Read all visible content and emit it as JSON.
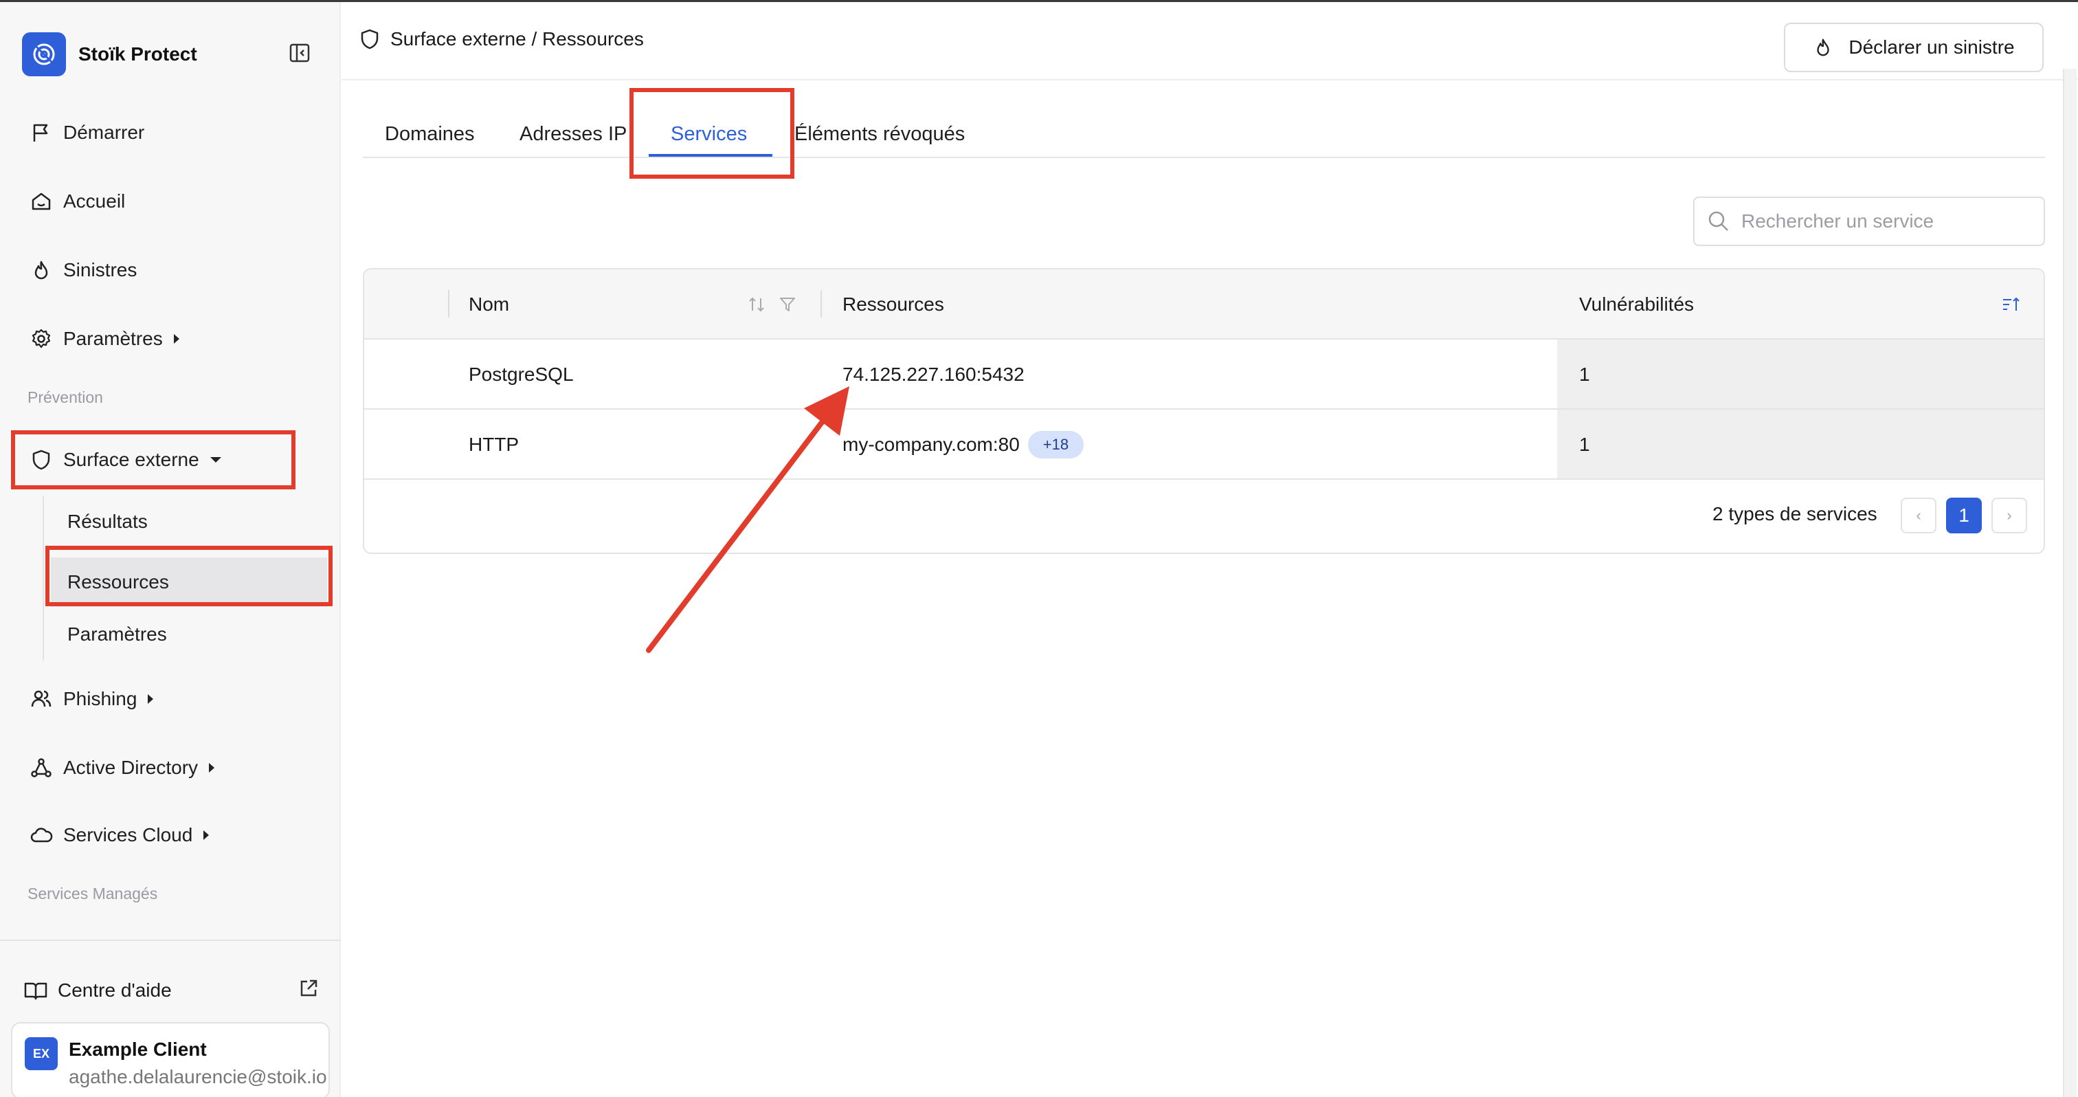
{
  "app": {
    "name": "Stoïk Protect"
  },
  "sidebar": {
    "items": [
      {
        "label": "Démarrer",
        "icon": "flag-icon"
      },
      {
        "label": "Accueil",
        "icon": "home-icon"
      },
      {
        "label": "Sinistres",
        "icon": "flame-icon"
      },
      {
        "label": "Paramètres",
        "icon": "gear-icon"
      }
    ],
    "section_prevention": "Prévention",
    "surface": {
      "label": "Surface externe",
      "icon": "shield-icon"
    },
    "sub_items": [
      {
        "label": "Résultats"
      },
      {
        "label": "Ressources"
      },
      {
        "label": "Paramètres"
      }
    ],
    "items2": [
      {
        "label": "Phishing",
        "icon": "users-icon"
      },
      {
        "label": "Active Directory",
        "icon": "network-icon"
      },
      {
        "label": "Services Cloud",
        "icon": "cloud-icon"
      }
    ],
    "section_managed": "Services Managés",
    "help": "Centre d'aide",
    "user": {
      "initials": "EX",
      "name": "Example Client",
      "email": "agathe.delalaurencie@stoik.io"
    }
  },
  "header": {
    "breadcrumb": "Surface externe / Ressources",
    "declare_label": "Déclarer un sinistre"
  },
  "tabs": [
    {
      "label": "Domaines"
    },
    {
      "label": "Adresses IP"
    },
    {
      "label": "Services",
      "active": true
    },
    {
      "label": "Éléments révoqués"
    }
  ],
  "search": {
    "placeholder": "Rechercher un service"
  },
  "table": {
    "columns": {
      "name": "Nom",
      "resources": "Ressources",
      "vulns": "Vulnérabilités"
    },
    "rows": [
      {
        "name": "PostgreSQL",
        "resource": "74.125.227.160:5432",
        "extra": "",
        "vulns": "1"
      },
      {
        "name": "HTTP",
        "resource": "my-company.com:80",
        "extra": "+18",
        "vulns": "1"
      }
    ],
    "footer": {
      "count": "2 types de services",
      "page": "1"
    }
  },
  "colors": {
    "accent": "#2f5fd8",
    "annotation": "#e23d2c"
  }
}
